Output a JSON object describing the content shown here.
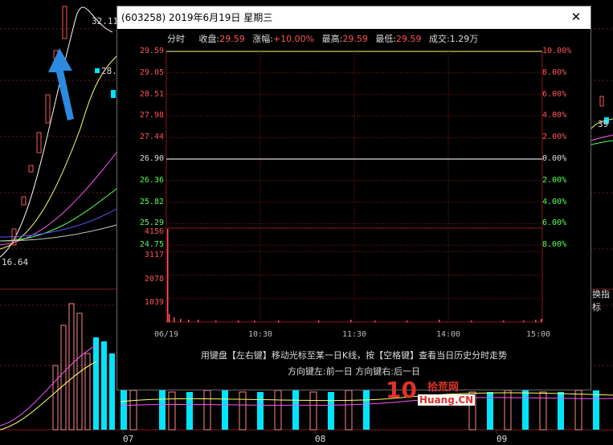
{
  "background": {
    "price_min_label": "16.64",
    "x_month_labels": [
      "07",
      "08",
      "09"
    ],
    "peak_price_label": "32.11",
    "partial_labels": [
      "28.",
      "39"
    ],
    "right_edge_label": "换指标"
  },
  "dialog": {
    "title": "(603258) 2019年6月19日 星期三",
    "close_label": "✕",
    "info": {
      "tab": "分时",
      "close_label": "收盘:",
      "close_value": "29.59",
      "change_label": "涨幅:",
      "change_value": "+10.00%",
      "high_label": "最高:",
      "high_value": "29.59",
      "low_label": "最低:",
      "low_value": "29.59",
      "volume_label": "成交:",
      "volume_value": "1.29万"
    },
    "price_axis": [
      "29.59",
      "29.05",
      "28.51",
      "27.98",
      "27.44",
      "26.90",
      "26.36",
      "25.82",
      "25.29",
      "24.75"
    ],
    "pct_axis": [
      "10.00%",
      "8.00%",
      "6.00%",
      "4.00%",
      "2.00%",
      "0.00%",
      "2.00%",
      "4.00%",
      "6.00%",
      "8.00%"
    ],
    "volume_axis": [
      "4156",
      "3117",
      "2078",
      "1039"
    ],
    "time_axis": [
      "06/19",
      "10:30",
      "11:30",
      "14:00",
      "15:00"
    ],
    "hint_line1": "用键盘【左右键】移动光标至某一日K线，按【空格键】查看当日历史分时走势",
    "hint_line2": "方向键左:前一日   方向键右:后一日"
  },
  "colors": {
    "up": "#ff5555",
    "down": "#55ff55",
    "neutral": "#dddddd",
    "cyan_bar": "#00e5ff",
    "yellow_line": "#ffff66",
    "grid": "#8b1a1a"
  },
  "watermark": {
    "number": "10",
    "chinese": "拾荒网",
    "english": "Huang.CN"
  }
}
